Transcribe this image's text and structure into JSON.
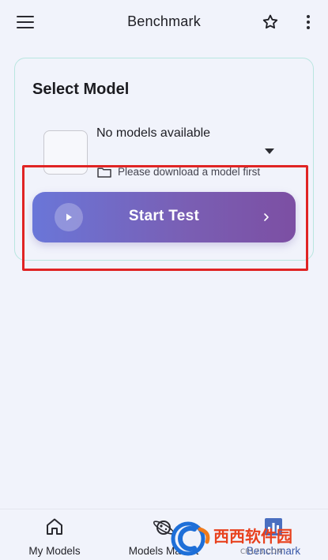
{
  "appbar": {
    "title": "Benchmark",
    "menu_icon": "menu-icon",
    "favorite_icon": "star-outline-icon",
    "more_icon": "more-vertical-icon"
  },
  "select_model": {
    "title": "Select Model",
    "model_name": "No models available",
    "hint": "Please download a model first",
    "start_label": "Start Test"
  },
  "bottom_nav": {
    "items": [
      {
        "label": "My Models",
        "icon": "home-icon"
      },
      {
        "label": "Models Market",
        "icon": "planet-icon"
      },
      {
        "label": "Benchmark",
        "icon": "chart-icon"
      }
    ],
    "active": "Benchmark"
  },
  "watermark": {
    "text": "西西软件园",
    "subtext": "CR173.COM"
  },
  "colors": {
    "background": "#f1f3fb",
    "button_gradient_start": "#6a76d8",
    "button_gradient_end": "#7c4fa3",
    "card_border": "#b9e6e0",
    "highlight": "#e02424",
    "active_nav": "#3b5aa8"
  }
}
